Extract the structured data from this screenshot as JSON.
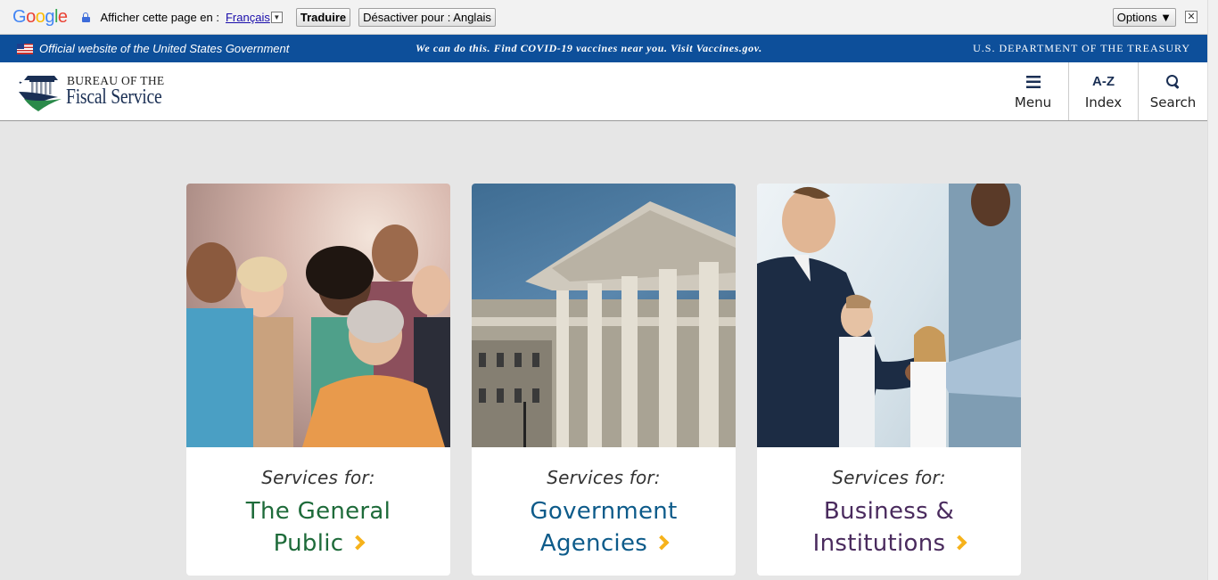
{
  "translate_bar": {
    "google_logo": [
      "G",
      "o",
      "o",
      "g",
      "l",
      "e"
    ],
    "google_logo_colors": [
      "#4285f4",
      "#ea4335",
      "#fbbc05",
      "#4285f4",
      "#34a853",
      "#ea4335"
    ],
    "prompt": "Afficher cette page en :",
    "language": "Français",
    "language_dropdown": "▼",
    "translate_label": "Traduire",
    "disable_label": "Désactiver pour : Anglais",
    "options_label": "Options ▼",
    "close_glyph": "✕"
  },
  "gov_banner": {
    "official": "Official website of the United States Government",
    "covid_notice": "We can do this. Find COVID-19 vaccines near you. Visit Vaccines.gov.",
    "treasury": "U.S. DEPARTMENT OF THE TREASURY",
    "background": "#0d4f9a"
  },
  "header": {
    "brand_line1": "BUREAU OF THE",
    "brand_line2": "Fiscal Service",
    "tools": [
      {
        "icon": "menu-icon",
        "label": "Menu"
      },
      {
        "icon": "az-icon",
        "icon_text": "A-Z",
        "label": "Index"
      },
      {
        "icon": "search-icon",
        "label": "Search"
      }
    ]
  },
  "cards": [
    {
      "kicker": "Services for:",
      "title_line1": "The General",
      "title_line2": "Public",
      "color": "#1e6b3a",
      "photo": "diverse-group-of-people"
    },
    {
      "kicker": "Services for:",
      "title_line1": "Government",
      "title_line2": "Agencies",
      "color": "#0d5b8a",
      "photo": "treasury-building"
    },
    {
      "kicker": "Services for:",
      "title_line1": "Business &",
      "title_line2": "Institutions",
      "color": "#4a2b5e",
      "photo": "business-handshake"
    }
  ],
  "accent": "#f6b21b"
}
